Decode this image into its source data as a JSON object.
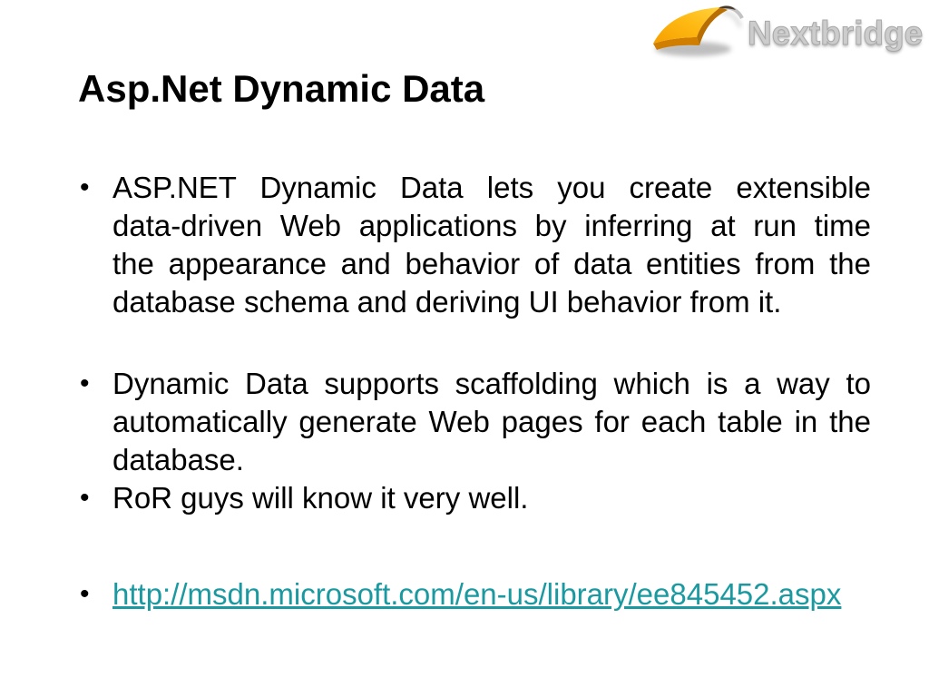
{
  "logo": {
    "brand": "Nextbridge",
    "arrow_icon": "swoosh-arrow-icon"
  },
  "slide": {
    "title": "Asp.Net Dynamic Data",
    "bullet_char": "•",
    "bullets": [
      {
        "lines": [
          "ASP.NET Dynamic Data lets you create extensible",
          "data-driven Web applications by inferring at run time",
          "the appearance and behavior of data entities from the",
          "database schema and deriving UI behavior from it."
        ]
      },
      {
        "lines": [
          "Dynamic Data supports scaffolding which is a way to",
          "automatically generate Web pages for each table in the",
          "database."
        ]
      },
      {
        "lines": [
          "RoR guys will know it very well."
        ]
      }
    ],
    "link": {
      "text": "http://msdn.microsoft.com/en-us/library/ee845452.aspx"
    }
  },
  "colors": {
    "background": "#ffffff",
    "text": "#000000",
    "link_teal": "#1a9aa0",
    "logo_orange_light": "#ffd23e",
    "logo_orange_dark": "#ef8e00",
    "logo_silver": "#cccccc"
  }
}
